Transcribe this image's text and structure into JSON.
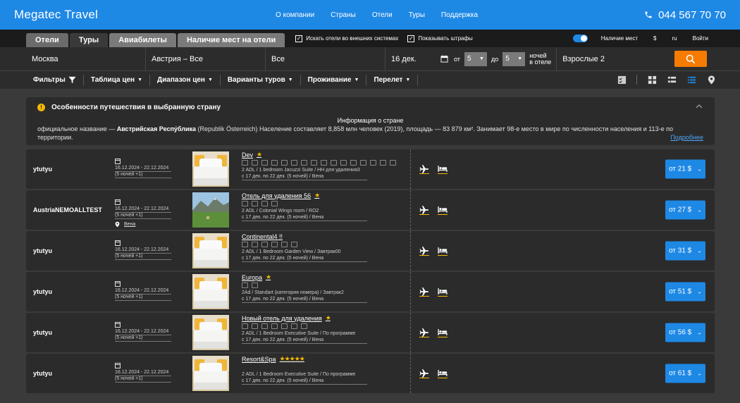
{
  "header": {
    "brand": "Megatec Travel",
    "nav": [
      "О компании",
      "Страны",
      "Отели",
      "Туры",
      "Поддержка"
    ],
    "phone": "044 567 70 70"
  },
  "tabs": {
    "items": [
      "Отели",
      "Туры",
      "Авиабилеты",
      "Наличие мест на отели"
    ],
    "active": "Туры",
    "check_external": "Искать отели во внешних системах",
    "check_penalty": "Показывать штрафы",
    "availability": "Наличие мест",
    "currency": "$",
    "lang": "ru",
    "login": "Войти"
  },
  "search": {
    "country": "Москва",
    "region": "Австрия – Все",
    "city": "Все",
    "date": "16 дек.",
    "from_label": "от",
    "nights_from": "5",
    "to_label": "до",
    "nights_to": "5",
    "nights_label1": "ночей",
    "nights_label2": "в отеле",
    "adults": "Взрослые 2"
  },
  "filters": {
    "items": [
      "Фильтры",
      "Таблица цен",
      "Диапазон цен",
      "Варианты туров",
      "Проживание",
      "Перелет"
    ]
  },
  "notice": {
    "title": "Особенности путешествия в выбранную страну",
    "center": "Информация о стране",
    "pre": "официальное название — ",
    "bold": "Австрийская Респу́блика",
    "post": " (Republik Österreich) Население составляет 8,858 млн человек (2019), площадь — 83 879 км². Занимает 98-е место в мире по численности населения и 113-е по территории.",
    "more": "Подробнее"
  },
  "rows": [
    {
      "name": "ytutyu",
      "dates": "16.12.2024 - 22.12.2024",
      "nights": "(5 ночей +1)",
      "loc": "",
      "hotel": "Dev",
      "stars": "★",
      "room": "2 ADL / 1 bedroom Jacuzzi Suite / HH для удаления3",
      "period": "с 17 дек. по 22 дек. (5 ночей) / Вена",
      "price": "от 21 $",
      "amen": 16,
      "photo": "room"
    },
    {
      "name": "AustriaNEMOALLTEST",
      "dates": "16.12.2024 - 22.12.2024",
      "nights": "(5 ночей +1)",
      "loc": "Вена",
      "hotel": "Отель для удаления 56",
      "stars": "★",
      "room": "2 ADL / Colonial Wings room / RO2",
      "period": "с 17 дек. по 22 дек. (5 ночей) / Вена",
      "price": "от 27 $",
      "amen": 4,
      "photo": "mountain"
    },
    {
      "name": "ytutyu",
      "dates": "16.12.2024 - 22.12.2024",
      "nights": "(5 ночей +1)",
      "loc": "",
      "hotel": "Continental4 !!",
      "stars": "",
      "room": "2 ADL / 1 Bedroom Garden View / Завтрак00",
      "period": "с 17 дек. по 22 дек. (5 ночей) / Вена",
      "price": "от 31 $",
      "amen": 6,
      "photo": "room"
    },
    {
      "name": "ytutyu",
      "dates": "16.12.2024 - 22.12.2024",
      "nights": "(5 ночей +1)",
      "loc": "",
      "hotel": "Europa",
      "stars": "★",
      "room": "2Ad / Standart (категория номера) / Завтрак2",
      "period": "с 17 дек. по 22 дек. (5 ночей) / Вена",
      "price": "от 51 $",
      "amen": 2,
      "photo": "room"
    },
    {
      "name": "ytutyu",
      "dates": "16.12.2024 - 22.12.2024",
      "nights": "(5 ночей +1)",
      "loc": "",
      "hotel": "Новый отель для удаления",
      "stars": "★",
      "room": "2 ADL / 1 Bedroom Executive Suite / По программе",
      "period": "с 17 дек. по 22 дек. (5 ночей) / Вена",
      "price": "от 56 $",
      "amen": 7,
      "photo": "room"
    },
    {
      "name": "ytutyu",
      "dates": "16.12.2024 - 22.12.2024",
      "nights": "(5 ночей +1)",
      "loc": "",
      "hotel": "Resort&Spa",
      "stars": "★★★★★",
      "room": "2 ADL / 1 Bedroom Executive Suite / По программе",
      "period": "с 17 дек. по 22 дек. (5 ночей) / Вена",
      "price": "от 61 $",
      "amen": 0,
      "photo": "room"
    }
  ],
  "colors": {
    "accent": "#1e88e5",
    "search_button": "#f57c00",
    "star": "#f5b800"
  }
}
